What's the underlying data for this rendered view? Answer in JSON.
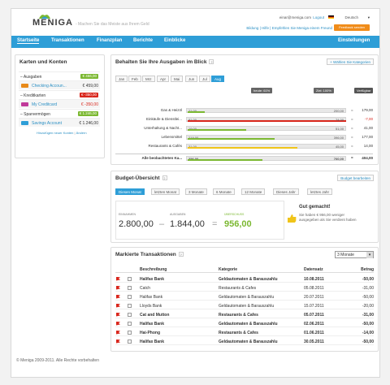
{
  "header": {
    "logo": "MENIGA",
    "slogan": "- Machen Sie das Meiste aus Ihrem Geld",
    "email": "einar@meniga.com",
    "logout": "Logout",
    "language": "Deutsch",
    "links": "Bildung | Hilfe | Empfehlen Sie Meniga einem Freund",
    "feedback": "Feedback senden"
  },
  "nav": {
    "items": [
      "Startseite",
      "Transaktionen",
      "Finanzplan",
      "Berichte",
      "Einblicke"
    ],
    "settings": "Einstellungen"
  },
  "sidebar": {
    "title": "Karten und Konten",
    "groups": [
      {
        "label": "– Ausgaben",
        "total": "€ 456,00",
        "color": "green",
        "accounts": [
          {
            "name": "Checking Accoun...",
            "value": "€ 459,00"
          }
        ]
      },
      {
        "label": "– Kreditkarten",
        "total": "€ -350,00",
        "color": "red",
        "accounts": [
          {
            "name": "My Creditcard",
            "value": "€ -350,00"
          }
        ]
      },
      {
        "label": "– Sparvermögen",
        "total": "€ 1.246,00",
        "color": "green",
        "accounts": [
          {
            "name": "Savings Account",
            "value": "€ 1.246,00"
          }
        ]
      }
    ],
    "add_link": "Hinzufügen neuer Konten",
    "edit_link": "Ändern"
  },
  "budget_overview": {
    "title": "Behalten Sie Ihre Ausgaben im Blick",
    "choose_link": "+ Wählen Sie Kategorien",
    "months": [
      "Jan",
      "Feb",
      "Mrz",
      "Apr",
      "Mai",
      "Jun",
      "Jul",
      "Aug"
    ],
    "selected_month": "Aug",
    "marker_today": "heute: 61%",
    "marker_target": "Ziel: 100%",
    "available_label": "Verfügbar",
    "rows": [
      {
        "category": "Gas & Heizöl",
        "spent": "21,00",
        "budget": "200,00",
        "op": "=",
        "remaining": "179,00",
        "fill": 0.11,
        "color": "#7bb831"
      },
      {
        "category": "Einkäufe & Dienstlei...",
        "spent": "81,00",
        "budget": "74,00",
        "op": "=",
        "remaining": "-7,00",
        "fill": 1.0,
        "color": "#d9261c"
      },
      {
        "category": "Unterhaltung & Nacht...",
        "spent": "19,00",
        "budget": "51,00",
        "op": "=",
        "remaining": "41,00",
        "fill": 0.37,
        "color": "#7bb831"
      },
      {
        "category": "Lebensmittel",
        "spent": "219,00",
        "budget": "396,00",
        "op": "=",
        "remaining": "177,00",
        "fill": 0.55,
        "color": "#7bb831"
      },
      {
        "category": "Restaurants & Cafés",
        "spent": "31,00",
        "budget": "45,00",
        "op": "=",
        "remaining": "14,00",
        "fill": 0.69,
        "color": "#f0c419"
      }
    ],
    "total": {
      "category": "Alle beobachteten Ka...",
      "spent": "356,00",
      "budget": "760,00",
      "op": "=",
      "remaining": "404,00",
      "fill": 0.47,
      "color": "#7bb831"
    }
  },
  "budget": {
    "title": "Budget-Übersicht",
    "edit": "Budget bearbeiten",
    "periods": [
      "Diesen Monat",
      "letzten Monat",
      "3 Monate",
      "6 Monate",
      "12 Monate",
      "Dieses Jahr",
      "letztes Jahr"
    ],
    "income_label": "Einnahmen",
    "income": "2.800,00",
    "minus": "–",
    "expense_label": "Ausgaben",
    "expense": "1.844,00",
    "equals": "=",
    "surplus_label": "Überschuss",
    "surplus": "956,00",
    "message_title": "Gut gemacht!",
    "message": "Sie haben € 956,00 weniger ausgegeben als Sie verdient haben"
  },
  "transactions": {
    "title": "Markierte Transaktionen",
    "filter": "3 Monate",
    "headers": [
      "Beschreibung",
      "Kategorie",
      "Datensatz",
      "Betrag"
    ],
    "rows": [
      {
        "desc": "Halifax Bank",
        "cat": "Geldautomaten & Barauszahlu",
        "date": "10.08.2011",
        "amount": "-50,00",
        "bold": true
      },
      {
        "desc": "Catch",
        "cat": "Restaurants & Cafes",
        "date": "05.08.2011",
        "amount": "-31,00",
        "bold": false
      },
      {
        "desc": "Halifax Bank",
        "cat": "Geldautomaten & Barauszahlu",
        "date": "20.07.2011",
        "amount": "-50,00",
        "bold": false
      },
      {
        "desc": "Lloyds Bank",
        "cat": "Geldautomaten & Barauszahlu",
        "date": "15.07.2011",
        "amount": "-20,00",
        "bold": false
      },
      {
        "desc": "Cat and Mutton",
        "cat": "Restaurants & Cafes",
        "date": "05.07.2011",
        "amount": "-31,00",
        "bold": true
      },
      {
        "desc": "Halifax Bank",
        "cat": "Geldautomaten & Barauszahlu",
        "date": "02.06.2011",
        "amount": "-50,00",
        "bold": true
      },
      {
        "desc": "Hai-Phong",
        "cat": "Restaurants & Cafes",
        "date": "01.06.2011",
        "amount": "-14,00",
        "bold": true
      },
      {
        "desc": "Halifax Bank",
        "cat": "Geldautomaten & Barauszahlu",
        "date": "30.05.2011",
        "amount": "-50,00",
        "bold": true
      }
    ]
  },
  "footer": "© Meniga 2009-2011. Alle Rechte vorbehalten"
}
